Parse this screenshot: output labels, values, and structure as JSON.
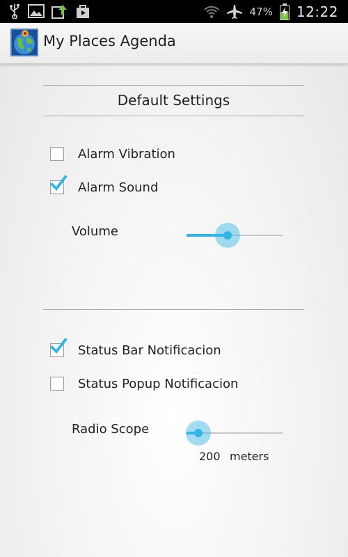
{
  "status_bar": {
    "battery_percent": "47%",
    "time": "12:22",
    "icons": [
      "usb-icon",
      "gallery-icon",
      "upload-icon",
      "store-icon",
      "wifi-icon",
      "airplane-icon",
      "battery-charging-icon"
    ]
  },
  "app_bar": {
    "title": "My Places Agenda",
    "icon": "globe-icon"
  },
  "settings": {
    "header": "Default Settings",
    "alarm_vibration": {
      "label": "Alarm Vibration",
      "checked": false
    },
    "alarm_sound": {
      "label": "Alarm Sound",
      "checked": true
    },
    "volume": {
      "label": "Volume",
      "level_fraction": 0.43
    },
    "status_bar_notification": {
      "label": "Status Bar Notificacion",
      "checked": true
    },
    "status_popup_notification": {
      "label": "Status Popup Notificacion",
      "checked": false
    },
    "radio_scope": {
      "label": "Radio Scope",
      "value": "200",
      "unit": "meters",
      "level_fraction": 0.12
    }
  },
  "colors": {
    "accent": "#33b5e5",
    "status_bar": "#000000"
  }
}
